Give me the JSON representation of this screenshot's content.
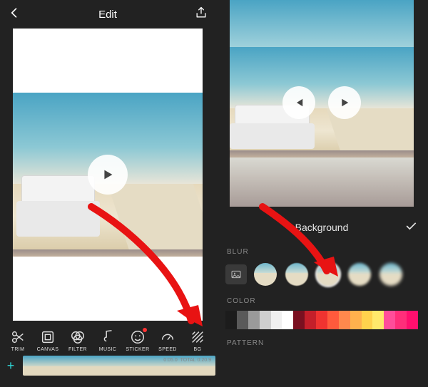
{
  "left": {
    "title": "Edit",
    "toolbar": [
      {
        "id": "trim",
        "label": "TRIM"
      },
      {
        "id": "canvas",
        "label": "CANVAS"
      },
      {
        "id": "filter",
        "label": "FILTER"
      },
      {
        "id": "music",
        "label": "MUSIC"
      },
      {
        "id": "sticker",
        "label": "STICKER",
        "hasDot": true
      },
      {
        "id": "speed",
        "label": "SPEED"
      },
      {
        "id": "bg",
        "label": "BG"
      }
    ],
    "timeline": {
      "currentTime": "0:05.0",
      "totalLabel": "TOTAL",
      "totalTime": "0:20.9"
    }
  },
  "right": {
    "panelTitle": "Background",
    "sections": {
      "blur": "BLUR",
      "color": "COLOR",
      "pattern": "PATTERN"
    },
    "blurOptions": [
      {
        "id": "blur-1",
        "selected": false
      },
      {
        "id": "blur-2",
        "selected": false
      },
      {
        "id": "blur-3",
        "selected": true
      },
      {
        "id": "blur-4",
        "selected": false
      },
      {
        "id": "blur-5",
        "selected": false
      }
    ],
    "colorSwatches": [
      "#1c1c1c",
      "#5a5a5a",
      "#9a9a9a",
      "#cfcfcf",
      "#f0f0f0",
      "#ffffff",
      "#7a1020",
      "#c41f2a",
      "#ef3330",
      "#ff5a3c",
      "#ff884d",
      "#ffb14d",
      "#ffd24d",
      "#ffe96b",
      "#ff4d9a",
      "#ff2e7a",
      "#ff0f6e"
    ]
  }
}
